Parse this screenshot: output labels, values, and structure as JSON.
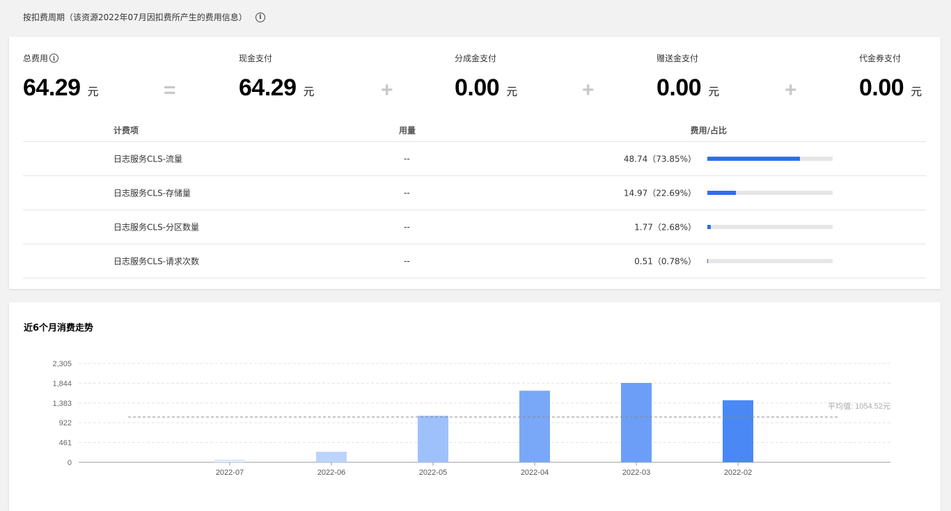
{
  "header": {
    "text": "按扣费周期（该资源2022年07月因扣费所产生的费用信息）"
  },
  "summary": {
    "total": {
      "label": "总费用",
      "value": "64.29",
      "unit": "元"
    },
    "cash": {
      "label": "现金支付",
      "value": "64.29",
      "unit": "元"
    },
    "share": {
      "label": "分成金支付",
      "value": "0.00",
      "unit": "元"
    },
    "gift": {
      "label": "赠送金支付",
      "value": "0.00",
      "unit": "元"
    },
    "voucher": {
      "label": "代金券支付",
      "value": "0.00",
      "unit": "元"
    },
    "op_equals": "=",
    "op_plus": "+"
  },
  "table": {
    "headers": {
      "name": "计费项",
      "usage": "用量",
      "fee": "费用/占比"
    },
    "rows": [
      {
        "name": "日志服务CLS-流量",
        "usage": "--",
        "fee": "48.74（73.85%）",
        "share": 0.7385
      },
      {
        "name": "日志服务CLS-存储量",
        "usage": "--",
        "fee": "14.97（22.69%）",
        "share": 0.2269
      },
      {
        "name": "日志服务CLS-分区数量",
        "usage": "--",
        "fee": "1.77（2.68%）",
        "share": 0.0268
      },
      {
        "name": "日志服务CLS-请求次数",
        "usage": "--",
        "fee": "0.51（0.78%）",
        "share": 0.0078
      }
    ]
  },
  "colors": {
    "bar_accent": "#2f6fe8",
    "track": "#e6e6e6"
  },
  "chart_data": {
    "type": "bar",
    "title": "近6个月消费走势",
    "categories": [
      "2022-07",
      "2022-06",
      "2022-05",
      "2022-04",
      "2022-03",
      "2022-02"
    ],
    "values": [
      64.29,
      245,
      1085,
      1668,
      1850,
      1445
    ],
    "bar_colors": [
      "#dfe9fb",
      "#bcd3fb",
      "#9fc1fb",
      "#7aa8f8",
      "#6c9ef7",
      "#4a88f5"
    ],
    "yticks": [
      "0",
      "461",
      "922",
      "1,383",
      "1,844",
      "2,305"
    ],
    "ylim": [
      0,
      2305
    ],
    "average": {
      "value": 1054.52,
      "label": "平均值: 1054.52元"
    },
    "grid": true
  }
}
